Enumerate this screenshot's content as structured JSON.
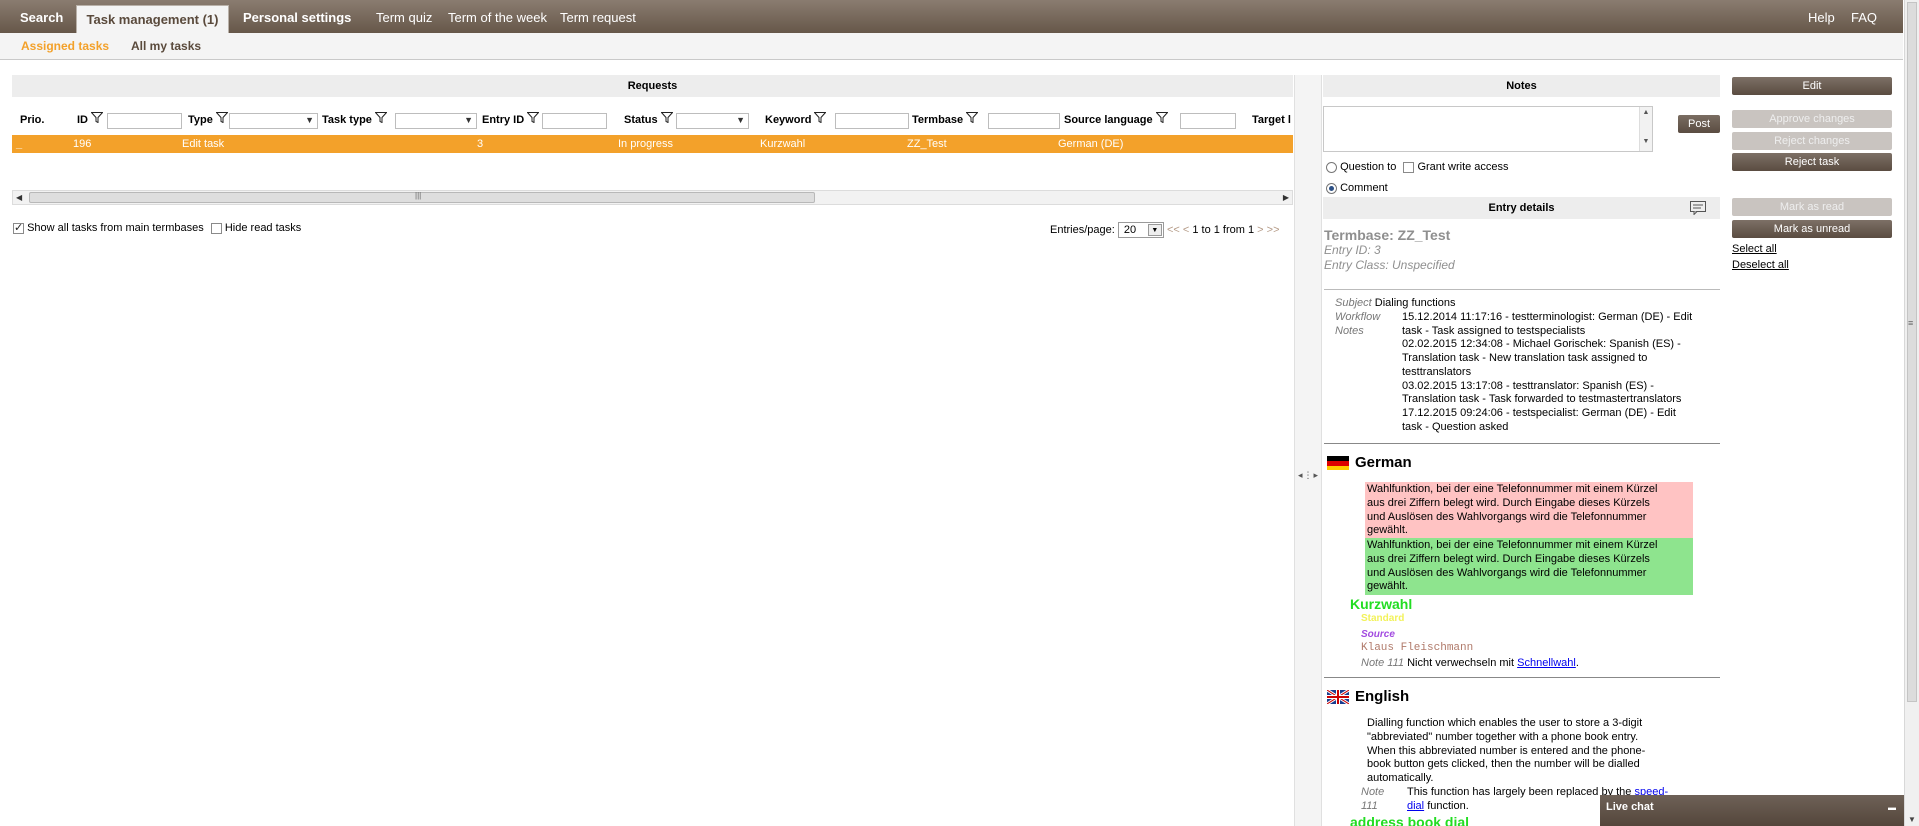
{
  "topnav": {
    "tabs": [
      "Search",
      "Task management (1)",
      "Personal settings"
    ],
    "links": [
      "Term quiz",
      "Term of the week",
      "Term request"
    ],
    "right": [
      "Help",
      "FAQ"
    ]
  },
  "subnav": {
    "assigned": "Assigned tasks",
    "all": "All my tasks"
  },
  "requests": {
    "title": "Requests",
    "columns": [
      "Prio.",
      "ID",
      "Type",
      "Task type",
      "Entry ID",
      "Status",
      "Keyword",
      "Termbase",
      "Source language",
      "Target l"
    ],
    "row": {
      "prio": "_",
      "id": "196",
      "type": "Edit task",
      "task_type": "",
      "entry_id": "3",
      "status": "In progress",
      "keyword": "Kurzwahl",
      "termbase": "ZZ_Test",
      "source_language": "German (DE)"
    },
    "show_all": "Show all tasks from main termbases",
    "hide_read": "Hide read tasks",
    "entries_label": "Entries/page:",
    "entries_value": "20",
    "pager_prev": "<< <",
    "pager_text": "1 to 1 from 1",
    "pager_next": "> >>"
  },
  "notes": {
    "title": "Notes",
    "post": "Post",
    "question_to": "Question to",
    "grant_write": "Grant write access",
    "comment": "Comment"
  },
  "entry": {
    "title": "Entry details",
    "termbase": "Termbase: ZZ_Test",
    "entry_id": "Entry ID: 3",
    "entry_class": "Entry Class: Unspecified",
    "subject_label": "Subject",
    "subject": "Dialing functions",
    "workflow_label": "Workflow",
    "notes_label": "Notes",
    "workflow_lines": [
      "15.12.2014 11:17:16 - testterminologist: German (DE) - Edit",
      "task - Task assigned to testspecialists",
      "02.02.2015 12:34:08 - Michael Gorischek: Spanish (ES) -",
      "Translation task - New translation task assigned to",
      "testtranslators",
      "03.02.2015 13:17:08 - testtranslator: Spanish (ES) -",
      "Translation task - Task forwarded to testmastertranslators",
      "17.12.2015 09:24:06 - testspecialist: German (DE) - Edit",
      "task - Question asked"
    ],
    "german": {
      "name": "German",
      "def_old": [
        "Wahlfunktion, bei der eine Telefonnummer mit einem Kürzel",
        "aus drei Ziffern belegt wird. Durch Eingabe dieses Kürzels",
        "und Auslösen des Wahlvorgangs wird die Telefonnummer",
        "gewählt."
      ],
      "def_new": [
        "Wahlfunktion, bei der eine Telefonnummer mit einem Kürzel",
        "aus drei Ziffern belegt wird. Durch Eingabe dieses Kürzels",
        "und Auslösen des Wahlvorgangs wird die Telefonnummer",
        "gewählt."
      ],
      "term": "Kurzwahl",
      "standard": "Standard",
      "source_label": "Source",
      "source": "Klaus Fleischmann",
      "note_label": "Note 111",
      "note_text": "Nicht verwechseln mit",
      "note_link": "Schnellwahl",
      "note_end": "."
    },
    "english": {
      "name": "English",
      "def": [
        "Dialling function which enables the user to store a 3-digit",
        "\"abbreviated\" number together with a phone book entry.",
        "When this abbreviated number is entered and the phone-",
        "book button gets clicked, then the number will be dialled",
        "automatically."
      ],
      "note_label_1": "Note",
      "note_label_2": "111",
      "note_text": "This function has largely been replaced by the",
      "note_link_1": "speed-",
      "note_link_2": "dial",
      "note_end": "function.",
      "term": "address book dial"
    }
  },
  "actions": {
    "edit": "Edit",
    "approve": "Approve changes",
    "reject_changes": "Reject changes",
    "reject_task": "Reject task",
    "mark_read": "Mark as read",
    "mark_unread": "Mark as unread",
    "select_all": "Select all",
    "deselect_all": "Deselect all"
  },
  "livechat": {
    "label": "Live chat",
    "min": "▬"
  },
  "colors": {
    "accent": "#f3a12a",
    "nav": "#665749",
    "active_sub": "#f3a12a"
  }
}
